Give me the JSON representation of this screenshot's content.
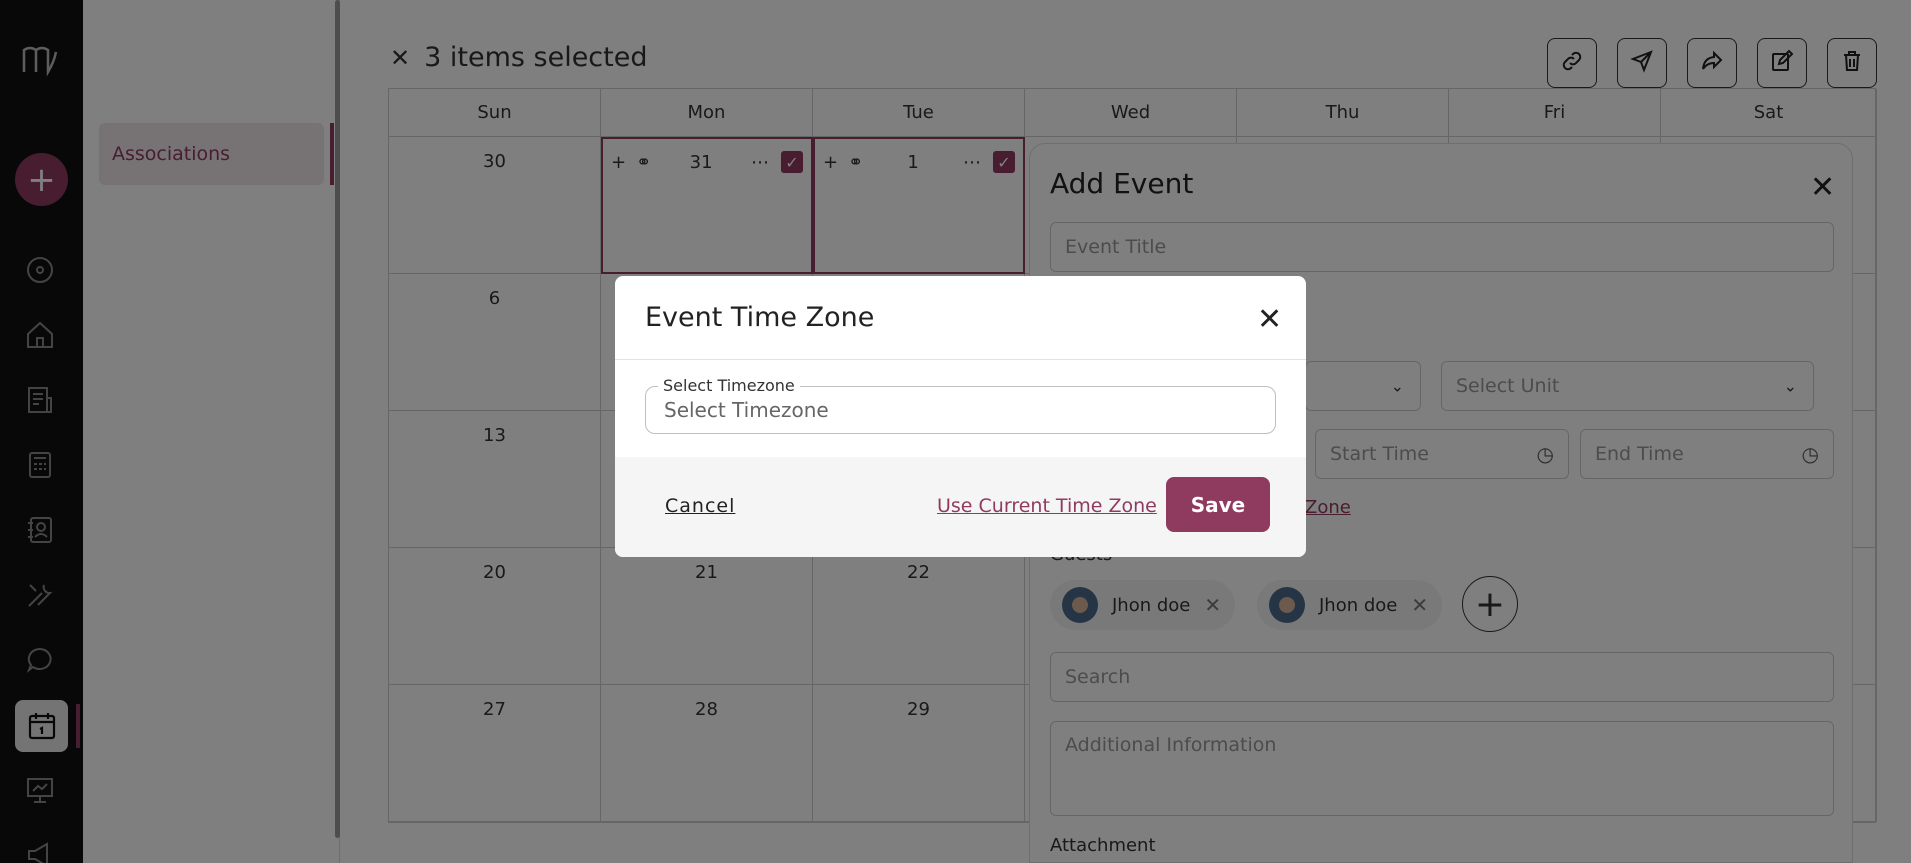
{
  "selection": {
    "close_icon": "close-icon",
    "text": "3 items selected"
  },
  "toolbar": {
    "icons": [
      "link-icon",
      "send-icon",
      "share-icon",
      "edit-icon",
      "trash-icon"
    ]
  },
  "sidebar": {
    "items": [
      {
        "label": "Associations"
      }
    ]
  },
  "rail": {
    "icons": [
      "logo-icon",
      "plus-icon",
      "dashboard-icon",
      "home-icon",
      "document-icon",
      "calculator-icon",
      "contacts-icon",
      "tools-icon",
      "chat-icon",
      "calendar-icon",
      "presentation-icon",
      "megaphone-icon"
    ]
  },
  "calendar": {
    "days": [
      "Sun",
      "Mon",
      "Tue",
      "Wed",
      "Thu",
      "Fri",
      "Sat"
    ],
    "rows": [
      [
        "30",
        "31",
        "1",
        "",
        "",
        "",
        ""
      ],
      [
        "6",
        "",
        "",
        "",
        "",
        "",
        ""
      ],
      [
        "13",
        "",
        "",
        "",
        "",
        "",
        ""
      ],
      [
        "20",
        "21",
        "22",
        "",
        "",
        "",
        ""
      ],
      [
        "27",
        "28",
        "29",
        "",
        "",
        "",
        ""
      ]
    ]
  },
  "add_event": {
    "title": "Add Event",
    "event_title_placeholder": "Event Title",
    "select_unit": "Select Unit",
    "start_time": "Start Time",
    "end_time": "End Time",
    "time_zone_link_fragment": "Zone",
    "guests_label": "Guests",
    "guests": [
      {
        "name": "Jhon doe"
      },
      {
        "name": "Jhon doe"
      }
    ],
    "search_placeholder": "Search",
    "additional_info_placeholder": "Additional Information",
    "attachment_label": "Attachment"
  },
  "modal": {
    "title": "Event Time Zone",
    "field_label": "Select Timezone",
    "field_placeholder": "Select Timezone",
    "cancel_label": "Cancel",
    "use_current_label": "Use Current Time Zone",
    "save_label": "Save"
  },
  "colors": {
    "accent": "#8f3a5f",
    "rail_bg": "#111111",
    "overlay": "rgba(0,0,0,0.5)"
  }
}
